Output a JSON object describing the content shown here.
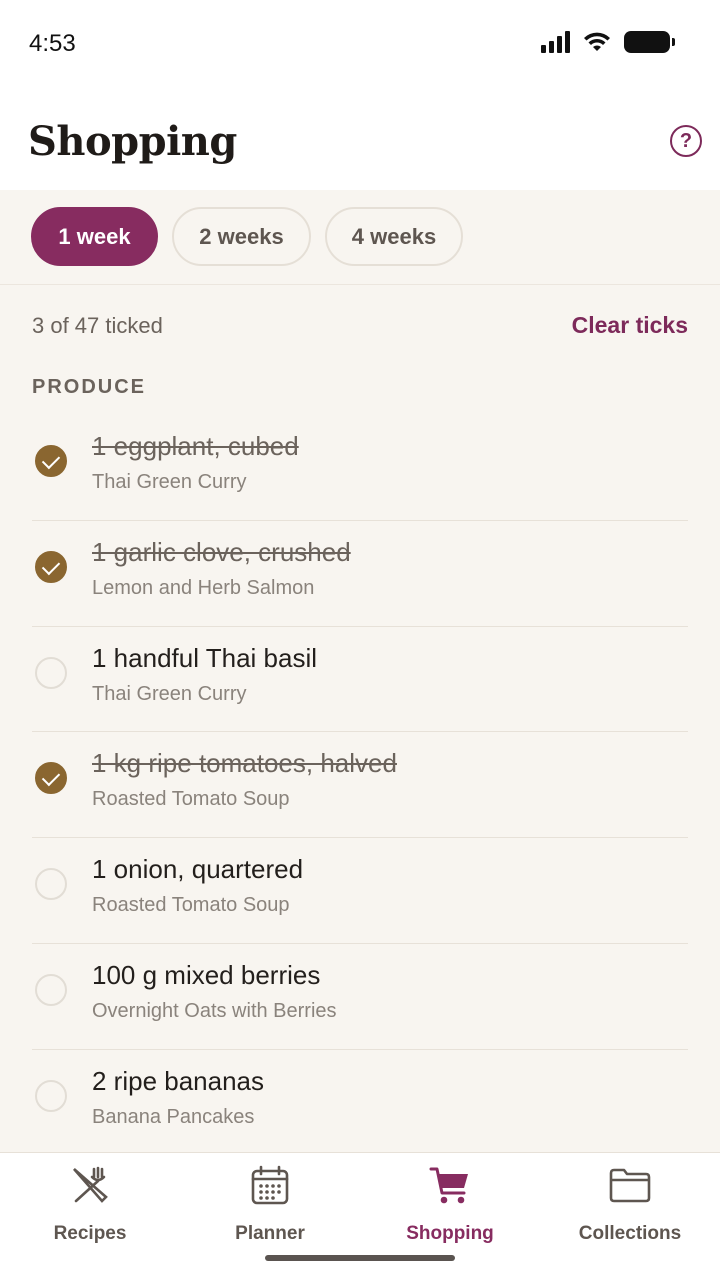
{
  "status": {
    "time": "4:53"
  },
  "header": {
    "title": "Shopping",
    "help_icon": "help-circle-icon"
  },
  "range": {
    "options": [
      "1 week",
      "2 weeks",
      "4 weeks"
    ],
    "selected": "1 week",
    "accent": "#872c60"
  },
  "summary": {
    "count_text": "3 of 47 ticked",
    "clear_label": "Clear ticks"
  },
  "section": {
    "title": "PRODUCE"
  },
  "items": [
    {
      "text": "1 eggplant, cubed",
      "recipe": "Thai Green Curry",
      "checked": true
    },
    {
      "text": "1 garlic clove, crushed",
      "recipe": "Lemon and Herb Salmon",
      "checked": true
    },
    {
      "text": "1 handful Thai basil",
      "recipe": "Thai Green Curry",
      "checked": false
    },
    {
      "text": "1 kg ripe tomatoes, halved",
      "recipe": "Roasted Tomato Soup",
      "checked": true
    },
    {
      "text": "1 onion, quartered",
      "recipe": "Roasted Tomato Soup",
      "checked": false
    },
    {
      "text": "100 g mixed berries",
      "recipe": "Overnight Oats with Berries",
      "checked": false
    },
    {
      "text": "2 ripe bananas",
      "recipe": "Banana Pancakes",
      "checked": false
    }
  ],
  "nav": {
    "items": [
      {
        "label": "Recipes",
        "icon": "utensils-icon"
      },
      {
        "label": "Planner",
        "icon": "calendar-icon"
      },
      {
        "label": "Shopping",
        "icon": "cart-icon"
      },
      {
        "label": "Collections",
        "icon": "folder-icon"
      }
    ],
    "active": "Shopping"
  },
  "colors": {
    "check": "#8a6630",
    "background": "#f8f5f0"
  }
}
